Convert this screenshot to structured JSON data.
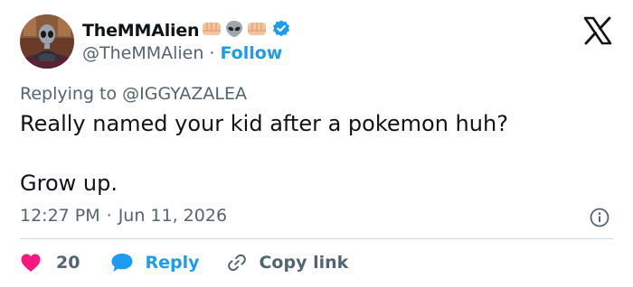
{
  "author": {
    "display_name": "TheMMAlien",
    "handle": "@TheMMAlien",
    "follow_label": "Follow",
    "name_emojis": [
      "fist-emoji",
      "alien-emoji",
      "fist-emoji"
    ],
    "verified": true
  },
  "reply_context": {
    "label": "Replying to @IGGYAZALEA"
  },
  "tweet": {
    "text": "Really named your kid after a pokemon huh?\n\nGrow up.",
    "time": "12:27 PM",
    "separator": "·",
    "date": "Jun 11, 2026"
  },
  "actions": {
    "like_count": "20",
    "reply_label": "Reply",
    "copy_link_label": "Copy link"
  },
  "colors": {
    "accent": "#1d9bf0",
    "like": "#f91880",
    "text": "#0f1419",
    "secondary": "#536471",
    "divider": "#cfd9de"
  },
  "icons": [
    "x-logo-icon",
    "verified-badge-icon",
    "info-icon",
    "heart-icon",
    "reply-bubble-icon",
    "link-icon"
  ]
}
